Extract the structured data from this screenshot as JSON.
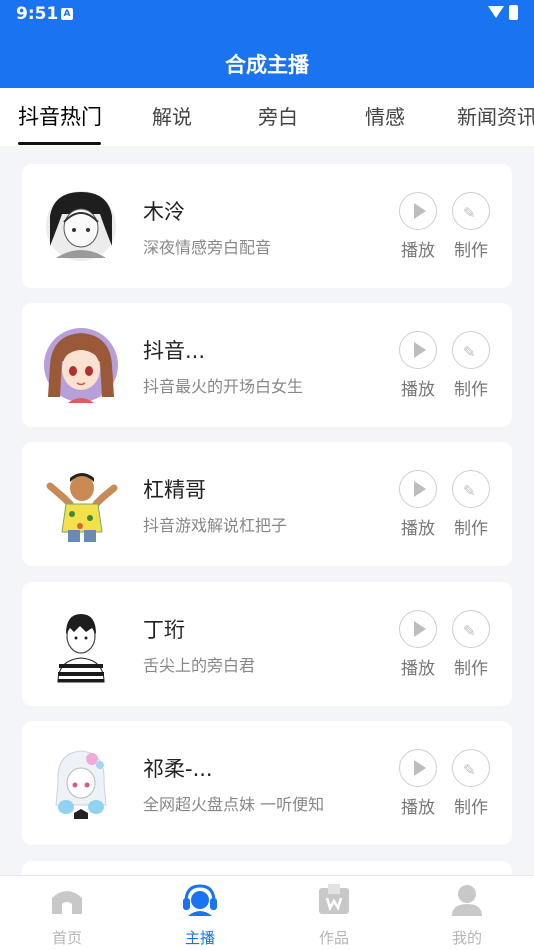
{
  "status_bar": {
    "time": "9:51",
    "notif": "A"
  },
  "header": {
    "title": "合成主播"
  },
  "tabs": [
    {
      "label": "抖音热门",
      "active": true
    },
    {
      "label": "解说"
    },
    {
      "label": "旁白"
    },
    {
      "label": "情感"
    },
    {
      "label": "新闻资讯"
    }
  ],
  "cards": [
    {
      "name": "木泠",
      "desc": "深夜情感旁白配音",
      "play": "播放",
      "edit": "制作"
    },
    {
      "name": "抖音...",
      "desc": "抖音最火的开场白女生",
      "play": "播放",
      "edit": "制作"
    },
    {
      "name": "杠精哥",
      "desc": "抖音游戏解说杠把子",
      "play": "播放",
      "edit": "制作"
    },
    {
      "name": "丁珩",
      "desc": "舌尖上的旁白君",
      "play": "播放",
      "edit": "制作"
    },
    {
      "name": "祁柔-...",
      "desc": "全网超火盘点妹 一听便知",
      "play": "播放",
      "edit": "制作"
    }
  ],
  "bottom_nav": [
    {
      "label": "首页",
      "icon": "home-icon"
    },
    {
      "label": "主播",
      "icon": "anchor-headset-icon",
      "active": true
    },
    {
      "label": "作品",
      "icon": "works-box-icon"
    },
    {
      "label": "我的",
      "icon": "profile-icon"
    }
  ],
  "colors": {
    "primary": "#1a73f0",
    "background": "#f4f5f9"
  }
}
